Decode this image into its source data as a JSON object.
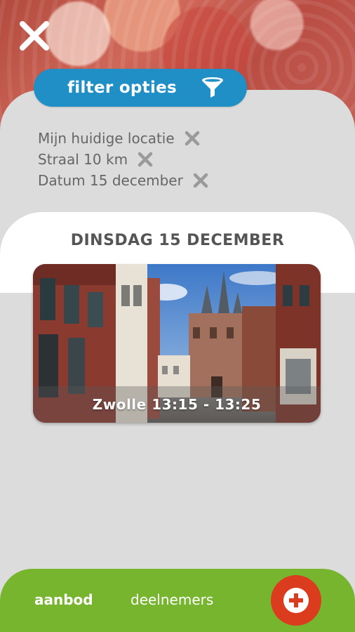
{
  "header": {
    "filter_label": "filter opties"
  },
  "icons": {
    "close": "close-icon",
    "filter": "funnel-icon",
    "remove": "close-icon",
    "add": "plus-icon"
  },
  "active_filters": [
    {
      "label": "Mijn huidige locatie"
    },
    {
      "label": "Straal 10 km"
    },
    {
      "label": "Datum 15 december"
    }
  ],
  "day": {
    "title": "DINSDAG 15 DECEMBER"
  },
  "events": [
    {
      "caption": "Zwolle 13:15 - 13:25"
    }
  ],
  "bottom_nav": {
    "tabs": [
      {
        "label": "aanbod",
        "active": true
      },
      {
        "label": "deelnemers",
        "active": false
      }
    ]
  },
  "colors": {
    "accent_blue": "#1f8fc6",
    "nav_green": "#77b52e",
    "add_red": "#dc3c1e"
  }
}
